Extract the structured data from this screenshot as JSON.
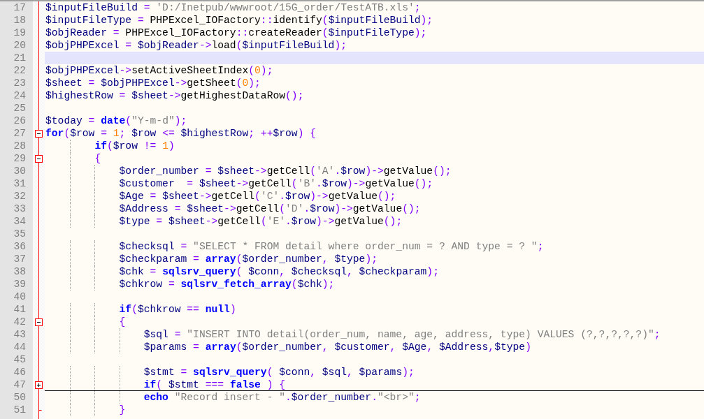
{
  "editor": {
    "lines": [
      {
        "number": "17",
        "current": false,
        "tokens": [
          {
            "kind": "v",
            "text": "$inputFileBuild"
          },
          {
            "kind": "o",
            "text": " = "
          },
          {
            "kind": "s",
            "text": "'D:/Inetpub/wwwroot/15G_order/TestATB.xls'"
          },
          {
            "kind": "o",
            "text": ";"
          }
        ]
      },
      {
        "number": "18",
        "current": false,
        "tokens": [
          {
            "kind": "v",
            "text": "$inputFileType"
          },
          {
            "kind": "o",
            "text": " = "
          },
          {
            "kind": "p",
            "text": "PHPExcel_IOFactory"
          },
          {
            "kind": "o",
            "text": "::"
          },
          {
            "kind": "p",
            "text": "identify"
          },
          {
            "kind": "o",
            "text": "("
          },
          {
            "kind": "v",
            "text": "$inputFileBuild"
          },
          {
            "kind": "o",
            "text": ");"
          }
        ]
      },
      {
        "number": "19",
        "current": false,
        "tokens": [
          {
            "kind": "v",
            "text": "$objReader"
          },
          {
            "kind": "o",
            "text": " = "
          },
          {
            "kind": "p",
            "text": "PHPExcel_IOFactory"
          },
          {
            "kind": "o",
            "text": "::"
          },
          {
            "kind": "p",
            "text": "createReader"
          },
          {
            "kind": "o",
            "text": "("
          },
          {
            "kind": "v",
            "text": "$inputFileType"
          },
          {
            "kind": "o",
            "text": ");"
          }
        ]
      },
      {
        "number": "20",
        "current": false,
        "tokens": [
          {
            "kind": "v",
            "text": "$objPHPExcel"
          },
          {
            "kind": "o",
            "text": " = "
          },
          {
            "kind": "v",
            "text": "$objReader"
          },
          {
            "kind": "o",
            "text": "->"
          },
          {
            "kind": "p",
            "text": "load"
          },
          {
            "kind": "o",
            "text": "("
          },
          {
            "kind": "v",
            "text": "$inputFileBuild"
          },
          {
            "kind": "o",
            "text": ");"
          }
        ]
      },
      {
        "number": "21",
        "current": true
      },
      {
        "number": "22",
        "current": false,
        "tokens": [
          {
            "kind": "v",
            "text": "$objPHPExcel"
          },
          {
            "kind": "o",
            "text": "->"
          },
          {
            "kind": "p",
            "text": "setActiveSheetIndex"
          },
          {
            "kind": "o",
            "text": "("
          },
          {
            "kind": "n",
            "text": "0"
          },
          {
            "kind": "o",
            "text": ");"
          }
        ]
      },
      {
        "number": "23",
        "current": false,
        "tokens": [
          {
            "kind": "v",
            "text": "$sheet"
          },
          {
            "kind": "o",
            "text": " = "
          },
          {
            "kind": "v",
            "text": "$objPHPExcel"
          },
          {
            "kind": "o",
            "text": "->"
          },
          {
            "kind": "p",
            "text": "getSheet"
          },
          {
            "kind": "o",
            "text": "("
          },
          {
            "kind": "n",
            "text": "0"
          },
          {
            "kind": "o",
            "text": ");"
          }
        ]
      },
      {
        "number": "24",
        "current": false,
        "tokens": [
          {
            "kind": "v",
            "text": "$highestRow"
          },
          {
            "kind": "o",
            "text": " = "
          },
          {
            "kind": "v",
            "text": "$sheet"
          },
          {
            "kind": "o",
            "text": "->"
          },
          {
            "kind": "p",
            "text": "getHighestDataRow"
          },
          {
            "kind": "o",
            "text": "();"
          }
        ]
      },
      {
        "number": "25",
        "current": false
      },
      {
        "number": "26",
        "current": false,
        "tokens": [
          {
            "kind": "v",
            "text": "$today"
          },
          {
            "kind": "o",
            "text": " = "
          },
          {
            "kind": "k",
            "text": "date"
          },
          {
            "kind": "o",
            "text": "("
          },
          {
            "kind": "s",
            "text": "\"Y-m-d\""
          },
          {
            "kind": "o",
            "text": ");"
          }
        ]
      },
      {
        "number": "27",
        "current": false,
        "kind": "fold-start",
        "collapsed": false,
        "tokens": [
          {
            "kind": "k",
            "text": "for"
          },
          {
            "kind": "o",
            "text": "("
          },
          {
            "kind": "v",
            "text": "$row"
          },
          {
            "kind": "o",
            "text": " = "
          },
          {
            "kind": "n",
            "text": "1"
          },
          {
            "kind": "o",
            "text": "; "
          },
          {
            "kind": "v",
            "text": "$row"
          },
          {
            "kind": "o",
            "text": " <= "
          },
          {
            "kind": "v",
            "text": "$highestRow"
          },
          {
            "kind": "o",
            "text": "; ++"
          },
          {
            "kind": "v",
            "text": "$row"
          },
          {
            "kind": "o",
            "text": ") {"
          }
        ]
      },
      {
        "number": "28",
        "current": false,
        "tokens": [
          {
            "kind": "k",
            "text": "\t\tif"
          },
          {
            "kind": "o",
            "text": "("
          },
          {
            "kind": "v",
            "text": "$row"
          },
          {
            "kind": "o",
            "text": " != "
          },
          {
            "kind": "n",
            "text": "1"
          },
          {
            "kind": "o",
            "text": ")"
          }
        ]
      },
      {
        "number": "29",
        "current": false,
        "kind": "fold-start",
        "collapsed": false,
        "tokens": [
          {
            "kind": "o",
            "text": "\t\t{"
          }
        ]
      },
      {
        "number": "30",
        "current": false,
        "tokens": [
          {
            "kind": "v",
            "text": "\t\t\t$order_number"
          },
          {
            "kind": "o",
            "text": " = "
          },
          {
            "kind": "v",
            "text": "$sheet"
          },
          {
            "kind": "o",
            "text": "->"
          },
          {
            "kind": "p",
            "text": "getCell"
          },
          {
            "kind": "o",
            "text": "("
          },
          {
            "kind": "s",
            "text": "'A'"
          },
          {
            "kind": "o",
            "text": "."
          },
          {
            "kind": "v",
            "text": "$row"
          },
          {
            "kind": "o",
            "text": ")->"
          },
          {
            "kind": "p",
            "text": "getValue"
          },
          {
            "kind": "o",
            "text": "();"
          }
        ]
      },
      {
        "number": "31",
        "current": false,
        "tokens": [
          {
            "kind": "v",
            "text": "\t\t\t$customer"
          },
          {
            "kind": "o",
            "text": "  = "
          },
          {
            "kind": "v",
            "text": "$sheet"
          },
          {
            "kind": "o",
            "text": "->"
          },
          {
            "kind": "p",
            "text": "getCell"
          },
          {
            "kind": "o",
            "text": "("
          },
          {
            "kind": "s",
            "text": "'B'"
          },
          {
            "kind": "o",
            "text": "."
          },
          {
            "kind": "v",
            "text": "$row"
          },
          {
            "kind": "o",
            "text": ")->"
          },
          {
            "kind": "p",
            "text": "getValue"
          },
          {
            "kind": "o",
            "text": "();"
          }
        ]
      },
      {
        "number": "32",
        "current": false,
        "tokens": [
          {
            "kind": "v",
            "text": "\t\t\t$Age"
          },
          {
            "kind": "o",
            "text": " = "
          },
          {
            "kind": "v",
            "text": "$sheet"
          },
          {
            "kind": "o",
            "text": "->"
          },
          {
            "kind": "p",
            "text": "getCell"
          },
          {
            "kind": "o",
            "text": "("
          },
          {
            "kind": "s",
            "text": "'C'"
          },
          {
            "kind": "o",
            "text": "."
          },
          {
            "kind": "v",
            "text": "$row"
          },
          {
            "kind": "o",
            "text": ")->"
          },
          {
            "kind": "p",
            "text": "getValue"
          },
          {
            "kind": "o",
            "text": "();"
          }
        ]
      },
      {
        "number": "33",
        "current": false,
        "tokens": [
          {
            "kind": "v",
            "text": "\t\t\t$Address"
          },
          {
            "kind": "o",
            "text": " = "
          },
          {
            "kind": "v",
            "text": "$sheet"
          },
          {
            "kind": "o",
            "text": "->"
          },
          {
            "kind": "p",
            "text": "getCell"
          },
          {
            "kind": "o",
            "text": "("
          },
          {
            "kind": "s",
            "text": "'D'"
          },
          {
            "kind": "o",
            "text": "."
          },
          {
            "kind": "v",
            "text": "$row"
          },
          {
            "kind": "o",
            "text": ")->"
          },
          {
            "kind": "p",
            "text": "getValue"
          },
          {
            "kind": "o",
            "text": "();"
          }
        ]
      },
      {
        "number": "34",
        "current": false,
        "tokens": [
          {
            "kind": "v",
            "text": "\t\t\t$type"
          },
          {
            "kind": "o",
            "text": " = "
          },
          {
            "kind": "v",
            "text": "$sheet"
          },
          {
            "kind": "o",
            "text": "->"
          },
          {
            "kind": "p",
            "text": "getCell"
          },
          {
            "kind": "o",
            "text": "("
          },
          {
            "kind": "s",
            "text": "'E'"
          },
          {
            "kind": "o",
            "text": "."
          },
          {
            "kind": "v",
            "text": "$row"
          },
          {
            "kind": "o",
            "text": ")->"
          },
          {
            "kind": "p",
            "text": "getValue"
          },
          {
            "kind": "o",
            "text": "();"
          }
        ]
      },
      {
        "number": "35",
        "current": false
      },
      {
        "number": "36",
        "current": false,
        "tokens": [
          {
            "kind": "v",
            "text": "\t\t\t$checksql"
          },
          {
            "kind": "o",
            "text": " = "
          },
          {
            "kind": "s",
            "text": "\"SELECT * FROM detail where order_num = ? AND type = ? \""
          },
          {
            "kind": "o",
            "text": ";"
          }
        ]
      },
      {
        "number": "37",
        "current": false,
        "tokens": [
          {
            "kind": "v",
            "text": "\t\t\t$checkparam"
          },
          {
            "kind": "o",
            "text": " = "
          },
          {
            "kind": "k",
            "text": "array"
          },
          {
            "kind": "o",
            "text": "("
          },
          {
            "kind": "v",
            "text": "$order_number"
          },
          {
            "kind": "o",
            "text": ", "
          },
          {
            "kind": "v",
            "text": "$type"
          },
          {
            "kind": "o",
            "text": ");"
          }
        ]
      },
      {
        "number": "38",
        "current": false,
        "tokens": [
          {
            "kind": "v",
            "text": "\t\t\t$chk"
          },
          {
            "kind": "o",
            "text": " = "
          },
          {
            "kind": "k",
            "text": "sqlsrv_query"
          },
          {
            "kind": "o",
            "text": "( "
          },
          {
            "kind": "v",
            "text": "$conn"
          },
          {
            "kind": "o",
            "text": ", "
          },
          {
            "kind": "v",
            "text": "$checksql"
          },
          {
            "kind": "o",
            "text": ", "
          },
          {
            "kind": "v",
            "text": "$checkparam"
          },
          {
            "kind": "o",
            "text": ");"
          }
        ]
      },
      {
        "number": "39",
        "current": false,
        "tokens": [
          {
            "kind": "v",
            "text": "\t\t\t$chkrow"
          },
          {
            "kind": "o",
            "text": " = "
          },
          {
            "kind": "k",
            "text": "sqlsrv_fetch_array"
          },
          {
            "kind": "o",
            "text": "("
          },
          {
            "kind": "v",
            "text": "$chk"
          },
          {
            "kind": "o",
            "text": ");"
          }
        ]
      },
      {
        "number": "40",
        "current": false
      },
      {
        "number": "41",
        "current": false,
        "tokens": [
          {
            "kind": "k",
            "text": "\t\t\tif"
          },
          {
            "kind": "o",
            "text": "("
          },
          {
            "kind": "v",
            "text": "$chkrow"
          },
          {
            "kind": "o",
            "text": " == "
          },
          {
            "kind": "k",
            "text": "null"
          },
          {
            "kind": "o",
            "text": ")"
          }
        ]
      },
      {
        "number": "42",
        "current": false,
        "kind": "fold-start",
        "collapsed": false,
        "tokens": [
          {
            "kind": "o",
            "text": "\t\t\t{"
          }
        ]
      },
      {
        "number": "43",
        "current": false,
        "tokens": [
          {
            "kind": "v",
            "text": "\t\t\t\t$sql"
          },
          {
            "kind": "o",
            "text": " = "
          },
          {
            "kind": "s",
            "text": "\"INSERT INTO detail(order_num, name, age, address, type) VALUES (?,?,?,?,?)\""
          },
          {
            "kind": "o",
            "text": ";"
          }
        ]
      },
      {
        "number": "44",
        "current": false,
        "tokens": [
          {
            "kind": "v",
            "text": "\t\t\t\t$params"
          },
          {
            "kind": "o",
            "text": " = "
          },
          {
            "kind": "k",
            "text": "array"
          },
          {
            "kind": "o",
            "text": "("
          },
          {
            "kind": "v",
            "text": "$order_number"
          },
          {
            "kind": "o",
            "text": ", "
          },
          {
            "kind": "v",
            "text": "$customer"
          },
          {
            "kind": "o",
            "text": ", "
          },
          {
            "kind": "v",
            "text": "$Age"
          },
          {
            "kind": "o",
            "text": ", "
          },
          {
            "kind": "v",
            "text": "$Address"
          },
          {
            "kind": "o",
            "text": ","
          },
          {
            "kind": "v",
            "text": "$type"
          },
          {
            "kind": "o",
            "text": ")"
          }
        ]
      },
      {
        "number": "45",
        "current": false
      },
      {
        "number": "46",
        "current": false,
        "tokens": [
          {
            "kind": "v",
            "text": "\t\t\t\t$stmt"
          },
          {
            "kind": "o",
            "text": " = "
          },
          {
            "kind": "k",
            "text": "sqlsrv_query"
          },
          {
            "kind": "o",
            "text": "( "
          },
          {
            "kind": "v",
            "text": "$conn"
          },
          {
            "kind": "o",
            "text": ", "
          },
          {
            "kind": "v",
            "text": "$sql"
          },
          {
            "kind": "o",
            "text": ", "
          },
          {
            "kind": "v",
            "text": "$params"
          },
          {
            "kind": "o",
            "text": ");"
          }
        ]
      },
      {
        "number": "47",
        "current": false,
        "kind": "fold-start",
        "collapsed": true,
        "tokens": [
          {
            "kind": "k",
            "text": "\t\t\t\tif"
          },
          {
            "kind": "o",
            "text": "( "
          },
          {
            "kind": "v",
            "text": "$stmt"
          },
          {
            "kind": "o",
            "text": " === "
          },
          {
            "kind": "k",
            "text": "false"
          },
          {
            "kind": "o",
            "text": " ) {"
          }
        ]
      },
      {
        "number": "50",
        "current": false,
        "tokens": [
          {
            "kind": "k",
            "text": "\t\t\t\techo"
          },
          {
            "kind": "s",
            "text": " \"Record insert - \""
          },
          {
            "kind": "o",
            "text": "."
          },
          {
            "kind": "v",
            "text": "$order_number"
          },
          {
            "kind": "o",
            "text": "."
          },
          {
            "kind": "s",
            "text": "\"<br>\""
          },
          {
            "kind": "o",
            "text": ";"
          }
        ]
      },
      {
        "number": "51",
        "current": false,
        "kind": "fold-end",
        "tokens": [
          {
            "kind": "o",
            "text": "\t\t\t}"
          }
        ]
      }
    ]
  }
}
